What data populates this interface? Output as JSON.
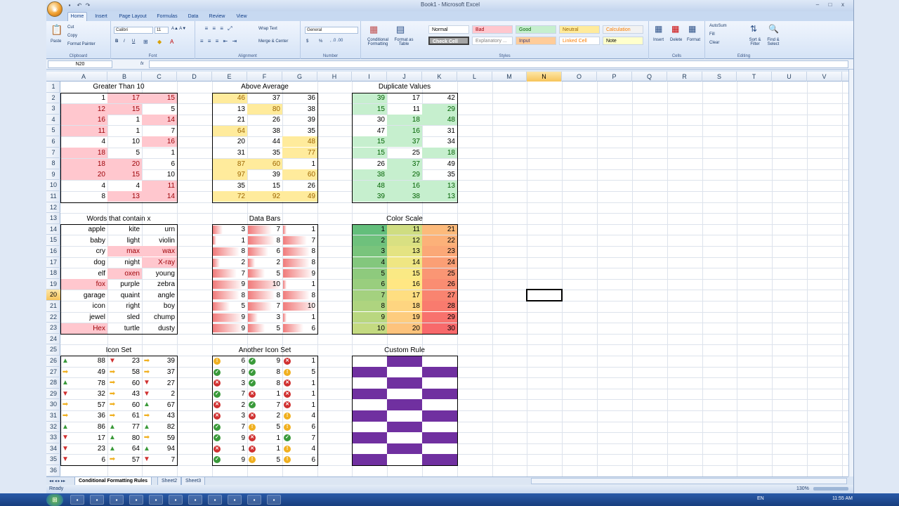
{
  "window": {
    "title": "Book1 - Microsoft Excel",
    "qat": [
      "save-icon",
      "undo-icon",
      "redo-icon"
    ],
    "controls": {
      "min": "–",
      "max": "□",
      "close": "x"
    }
  },
  "tabs": [
    "Home",
    "Insert",
    "Page Layout",
    "Formulas",
    "Data",
    "Review",
    "View"
  ],
  "ribbon": {
    "clipboard": {
      "label": "Clipboard",
      "paste": "Paste",
      "cut": "Cut",
      "copy": "Copy",
      "painter": "Format Painter"
    },
    "font": {
      "label": "Font",
      "name": "Calibri",
      "size": "11",
      "bold": "B",
      "italic": "I",
      "underline": "U"
    },
    "alignment": {
      "label": "Alignment",
      "wrap": "Wrap Text",
      "merge": "Merge & Center"
    },
    "number": {
      "label": "Number",
      "format": "General",
      "currency": "$",
      "percent": "%"
    },
    "styles": {
      "label": "Styles",
      "conditional": "Conditional Formatting",
      "table": "Format as Table",
      "cells": [
        {
          "text": "Normal",
          "bg": "#ffffff",
          "fg": "#000000"
        },
        {
          "text": "Bad",
          "bg": "#ffc7ce",
          "fg": "#9c0006"
        },
        {
          "text": "Good",
          "bg": "#c6efce",
          "fg": "#006100"
        },
        {
          "text": "Neutral",
          "bg": "#ffeb9c",
          "fg": "#9c6500"
        },
        {
          "text": "Calculation",
          "bg": "#f2f2f2",
          "fg": "#fa7d00"
        },
        {
          "text": "Check Cell",
          "bg": "#a5a5a5",
          "fg": "#ffffff"
        },
        {
          "text": "Explanatory ...",
          "bg": "#ffffff",
          "fg": "#7f7f7f"
        },
        {
          "text": "Input",
          "bg": "#ffcc99",
          "fg": "#3f3f76"
        },
        {
          "text": "Linked Cell",
          "bg": "#ffffff",
          "fg": "#fa7d00"
        },
        {
          "text": "Note",
          "bg": "#ffffcc",
          "fg": "#000000"
        }
      ]
    },
    "cellsgroup": {
      "label": "Cells",
      "insert": "Insert",
      "delete": "Delete",
      "format": "Format"
    },
    "editing": {
      "label": "Editing",
      "autosum": "AutoSum",
      "fill": "Fill",
      "clear": "Clear",
      "sort": "Sort & Filter",
      "find": "Find & Select"
    }
  },
  "formula_bar": {
    "name_box": "N20",
    "fx": "fx",
    "value": ""
  },
  "columns": [
    "A",
    "B",
    "C",
    "D",
    "E",
    "F",
    "G",
    "H",
    "I",
    "J",
    "K",
    "L",
    "M",
    "N",
    "O",
    "P",
    "Q",
    "R",
    "S",
    "T",
    "U",
    "V"
  ],
  "selected": {
    "col": "N",
    "row": "20"
  },
  "headings": {
    "gt": "Greater Than 10",
    "avg": "Above Average",
    "dup": "Duplicate Values",
    "words": "Words that contain x",
    "bars": "Data Bars",
    "scale": "Color Scale",
    "icons": "Icon Set",
    "icons2": "Another Icon Set",
    "custom": "Custom Rule"
  },
  "gt10": [
    [
      1,
      17,
      15
    ],
    [
      12,
      15,
      5
    ],
    [
      16,
      1,
      14
    ],
    [
      11,
      1,
      7
    ],
    [
      4,
      10,
      16
    ],
    [
      18,
      5,
      1
    ],
    [
      18,
      20,
      6
    ],
    [
      20,
      15,
      10
    ],
    [
      4,
      4,
      11
    ],
    [
      8,
      13,
      14
    ]
  ],
  "above_avg": [
    [
      46,
      37,
      36
    ],
    [
      13,
      80,
      38
    ],
    [
      21,
      26,
      39
    ],
    [
      64,
      38,
      35
    ],
    [
      20,
      44,
      48
    ],
    [
      31,
      35,
      77
    ],
    [
      87,
      60,
      1
    ],
    [
      97,
      39,
      60
    ],
    [
      35,
      15,
      26
    ],
    [
      72,
      92,
      49
    ]
  ],
  "duplicates": [
    [
      39,
      17,
      42
    ],
    [
      15,
      11,
      29
    ],
    [
      30,
      18,
      48
    ],
    [
      47,
      16,
      31
    ],
    [
      15,
      37,
      34
    ],
    [
      15,
      25,
      18
    ],
    [
      26,
      37,
      49
    ],
    [
      38,
      29,
      35
    ],
    [
      48,
      16,
      13
    ],
    [
      39,
      38,
      13
    ]
  ],
  "words": [
    [
      "apple",
      "kite",
      "urn"
    ],
    [
      "baby",
      "light",
      "violin"
    ],
    [
      "cry",
      "max",
      "wax"
    ],
    [
      "dog",
      "night",
      "X-ray"
    ],
    [
      "elf",
      "oxen",
      "young"
    ],
    [
      "fox",
      "purple",
      "zebra"
    ],
    [
      "garage",
      "quaint",
      "angle"
    ],
    [
      "icon",
      "right",
      "boy"
    ],
    [
      "jewel",
      "sled",
      "chump"
    ],
    [
      "Hex",
      "turtle",
      "dusty"
    ]
  ],
  "data_bars": [
    [
      3,
      7,
      1
    ],
    [
      1,
      8,
      7
    ],
    [
      8,
      6,
      8
    ],
    [
      2,
      2,
      8
    ],
    [
      7,
      5,
      9
    ],
    [
      9,
      10,
      1
    ],
    [
      8,
      8,
      8
    ],
    [
      5,
      7,
      10
    ],
    [
      9,
      3,
      1
    ],
    [
      9,
      5,
      6
    ]
  ],
  "color_scale": [
    [
      1,
      11,
      21
    ],
    [
      2,
      12,
      22
    ],
    [
      3,
      13,
      23
    ],
    [
      4,
      14,
      24
    ],
    [
      5,
      15,
      25
    ],
    [
      6,
      16,
      26
    ],
    [
      7,
      17,
      27
    ],
    [
      8,
      18,
      28
    ],
    [
      9,
      19,
      29
    ],
    [
      10,
      20,
      30
    ]
  ],
  "icon_set": [
    [
      88,
      23,
      39
    ],
    [
      49,
      58,
      37
    ],
    [
      78,
      60,
      27
    ],
    [
      32,
      43,
      2
    ],
    [
      57,
      60,
      67
    ],
    [
      36,
      61,
      43
    ],
    [
      86,
      77,
      82
    ],
    [
      17,
      80,
      59
    ],
    [
      23,
      64,
      94
    ],
    [
      6,
      57,
      7
    ]
  ],
  "icon_set2": [
    [
      6,
      9,
      1
    ],
    [
      9,
      8,
      5
    ],
    [
      3,
      8,
      1
    ],
    [
      7,
      1,
      1
    ],
    [
      2,
      7,
      1
    ],
    [
      3,
      2,
      4
    ],
    [
      7,
      5,
      6
    ],
    [
      9,
      1,
      7
    ],
    [
      1,
      1,
      4
    ],
    [
      9,
      5,
      6
    ]
  ],
  "colors": {
    "red_fill": "#ffc7ce",
    "red_text": "#9c0006",
    "yellow_fill": "#ffeb9c",
    "yellow_text": "#9c6500",
    "green_fill": "#c6efce",
    "green_text": "#006100",
    "purple": "#7030a0"
  },
  "sheets": [
    "Conditional Formatting Rules",
    "Sheet2",
    "Sheet3"
  ],
  "status": {
    "ready": "Ready",
    "zoom": "130%"
  },
  "taskbar": {
    "lang": "EN",
    "time": "11:55 AM"
  }
}
